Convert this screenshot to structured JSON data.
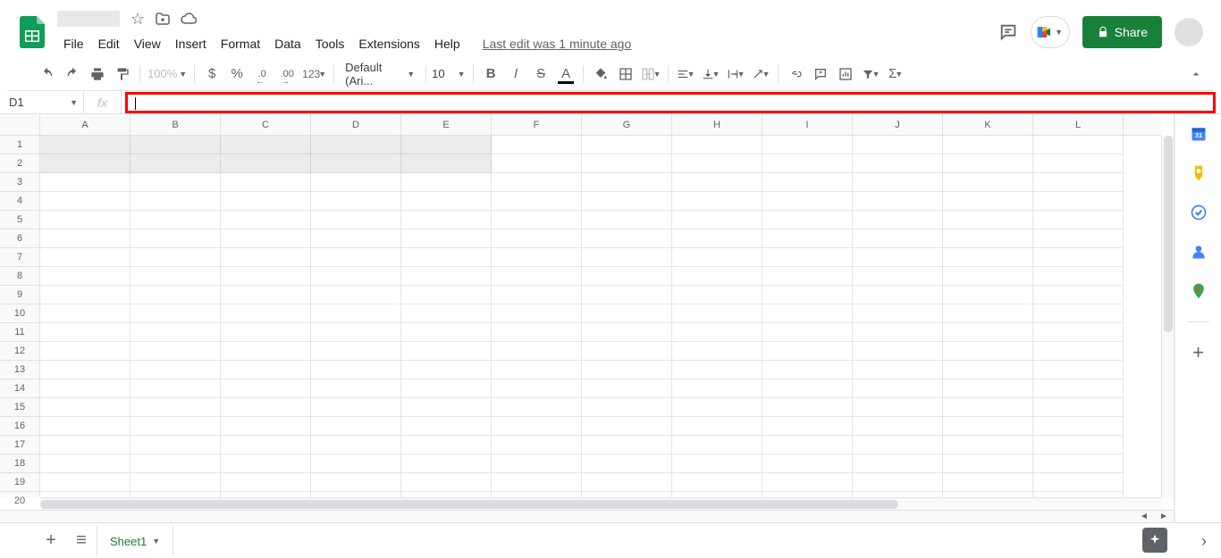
{
  "header": {
    "doc_title": "",
    "menus": [
      "File",
      "Edit",
      "View",
      "Insert",
      "Format",
      "Data",
      "Tools",
      "Extensions",
      "Help"
    ],
    "last_edit": "Last edit was 1 minute ago",
    "share_label": "Share"
  },
  "toolbar": {
    "zoom": "100%",
    "currency": "$",
    "percent": "%",
    "dec_dec": ".0",
    "inc_dec": ".00",
    "more_formats": "123",
    "font": "Default (Ari...",
    "font_size": "10"
  },
  "formula": {
    "name_box": "D1",
    "fx": "fx",
    "value": ""
  },
  "grid": {
    "columns": [
      "A",
      "B",
      "C",
      "D",
      "E",
      "F",
      "G",
      "H",
      "I",
      "J",
      "K",
      "L"
    ],
    "rows": [
      "1",
      "2",
      "3",
      "4",
      "5",
      "6",
      "7",
      "8",
      "9",
      "10",
      "11",
      "12",
      "13",
      "14",
      "15",
      "16",
      "17",
      "18",
      "19",
      "20"
    ]
  },
  "tabs": {
    "sheet1": "Sheet1"
  },
  "colors": {
    "share_green": "#188038",
    "highlight_red": "#ff0000"
  }
}
